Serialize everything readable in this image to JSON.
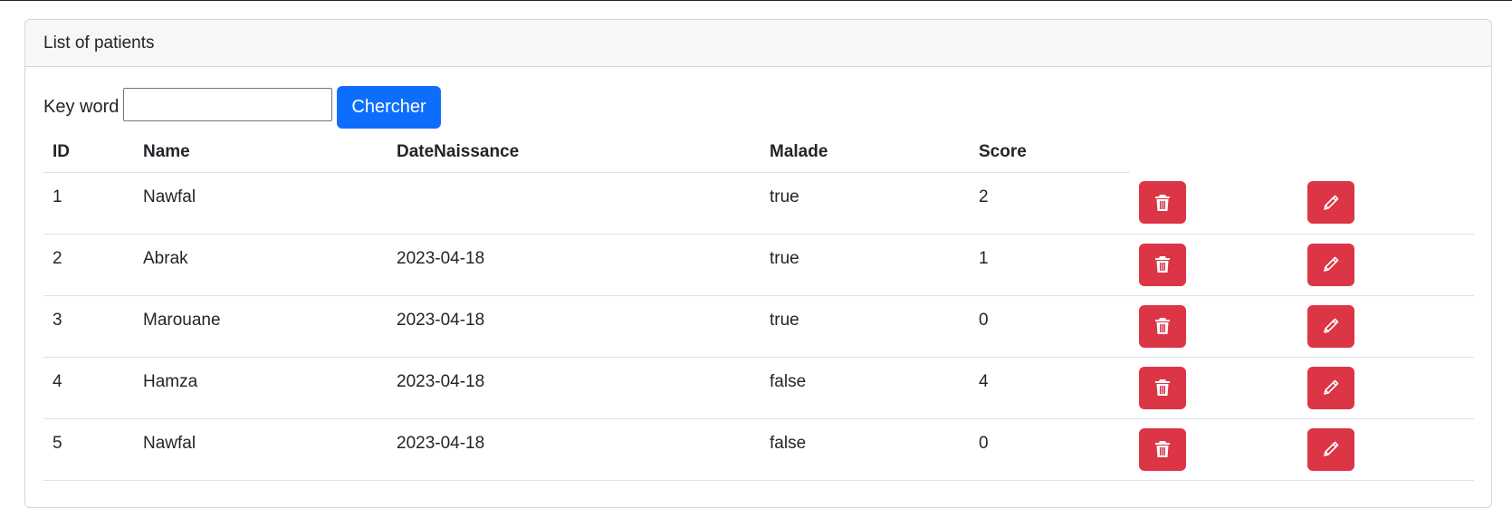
{
  "card": {
    "header_title": "List of patients"
  },
  "search": {
    "label": "Key word",
    "value": "",
    "placeholder": "",
    "button_label": "Chercher"
  },
  "table": {
    "columns": [
      "ID",
      "Name",
      "DateNaissance",
      "Malade",
      "Score"
    ],
    "rows": [
      {
        "id": "1",
        "name": "Nawfal",
        "date": "",
        "malade": "true",
        "score": "2"
      },
      {
        "id": "2",
        "name": "Abrak",
        "date": "2023-04-18",
        "malade": "true",
        "score": "1"
      },
      {
        "id": "3",
        "name": "Marouane",
        "date": "2023-04-18",
        "malade": "true",
        "score": "0"
      },
      {
        "id": "4",
        "name": "Hamza",
        "date": "2023-04-18",
        "malade": "false",
        "score": "4"
      },
      {
        "id": "5",
        "name": "Nawfal",
        "date": "2023-04-18",
        "malade": "false",
        "score": "0"
      }
    ]
  },
  "icons": {
    "delete": "trash-icon",
    "edit": "pencil-icon"
  },
  "colors": {
    "primary": "#0d6efd",
    "danger": "#dc3545",
    "header_bg": "#f7f7f7"
  }
}
